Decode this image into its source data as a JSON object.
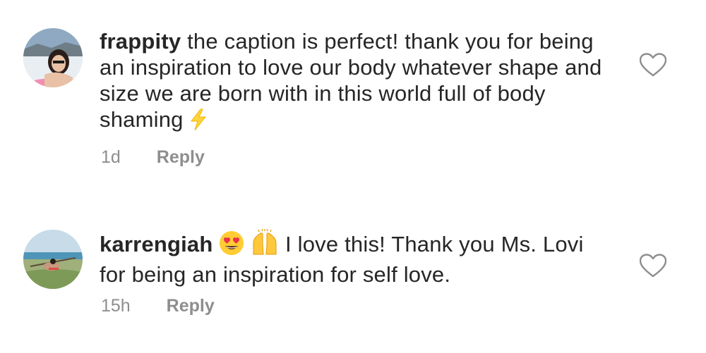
{
  "comments": [
    {
      "username": "frappity",
      "text": "the caption is perfect! thank you for being an inspiration to love our body whatever shape and size we are born with in this world full of body shaming",
      "emoji_after": "lightning-emoji",
      "time": "1d",
      "reply_label": "Reply"
    },
    {
      "username": "karrengiah",
      "emoji_before": [
        "heart-eyes-emoji",
        "raising-hands-emoji"
      ],
      "text": "I love this! Thank you Ms. Lovi for being an inspiration for self love.",
      "time": "15h",
      "reply_label": "Reply"
    }
  ],
  "colors": {
    "text": "#262626",
    "secondary": "#8e8e8e",
    "background": "#ffffff"
  }
}
